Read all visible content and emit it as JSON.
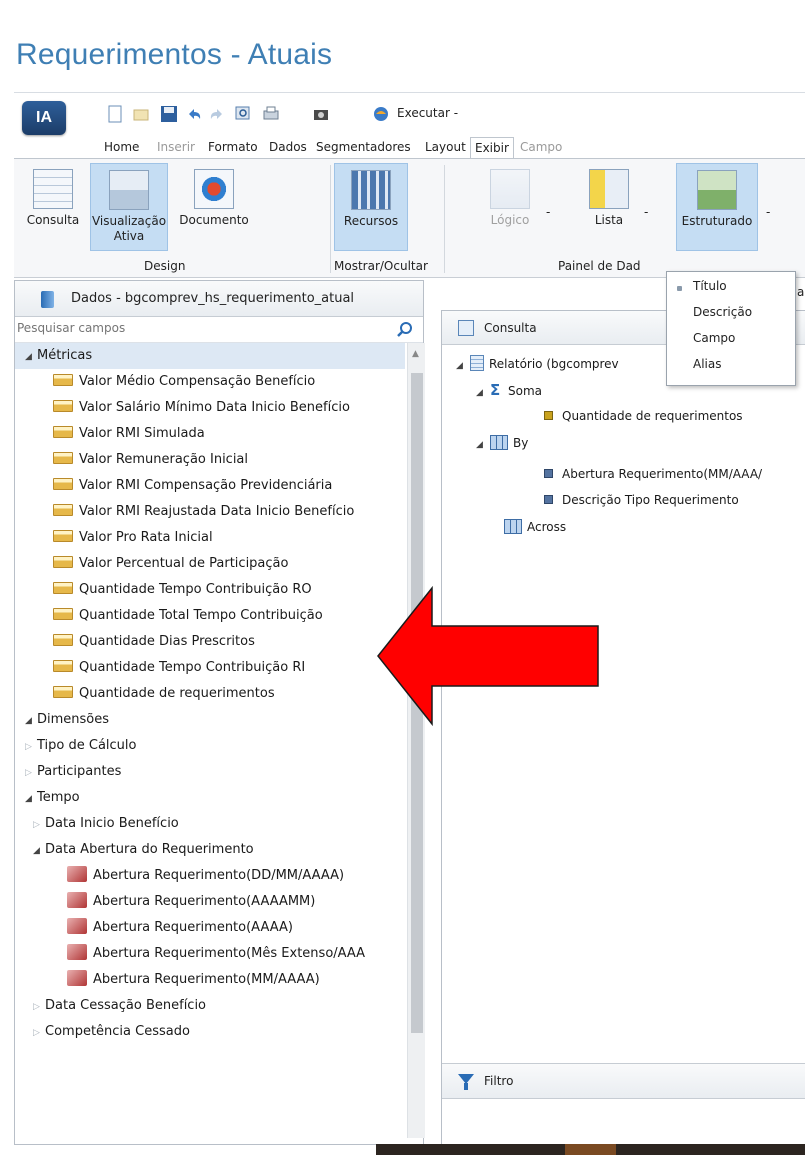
{
  "page": {
    "title": "Requerimentos - Atuais"
  },
  "toolbar": {
    "logo": "IA",
    "run_label": "Executar -",
    "tabs": [
      {
        "label": "Home",
        "state": "normal"
      },
      {
        "label": "Inserir",
        "state": "disabled"
      },
      {
        "label": "Formato",
        "state": "normal"
      },
      {
        "label": "Dados",
        "state": "normal"
      },
      {
        "label": "Segmentadores",
        "state": "normal"
      },
      {
        "label": "Layout",
        "state": "normal"
      },
      {
        "label": "Exibir",
        "state": "active"
      },
      {
        "label": "Campo",
        "state": "disabled"
      }
    ]
  },
  "ribbon": {
    "buttons": [
      {
        "label": "Consulta"
      },
      {
        "label": "Visualização Ativa"
      },
      {
        "label": "Documento"
      },
      {
        "label": "Recursos"
      },
      {
        "label": "Lógico"
      },
      {
        "label": "Lista"
      },
      {
        "label": "Estruturado"
      }
    ],
    "groups": [
      {
        "label": "Design"
      },
      {
        "label": "Mostrar/Ocultar"
      },
      {
        "label": "Painel de Dad"
      }
    ],
    "dropdown_arrows": [
      "-",
      "-",
      "-"
    ],
    "partial_char": "a"
  },
  "dropdown": {
    "items": [
      "Título",
      "Descrição",
      "Campo",
      "Alias"
    ]
  },
  "data_panel": {
    "title": "Dados - bgcomprev_hs_requerimento_atual",
    "search_placeholder": "Pesquisar campos",
    "tree": {
      "metricas": {
        "label": "Métricas",
        "items": [
          "Valor Médio Compensação Benefício",
          "Valor Salário Mínimo Data Inicio Benefício",
          "Valor RMI Simulada",
          "Valor Remuneração Inicial",
          "Valor RMI Compensação Previdenciária",
          "Valor RMI Reajustada Data Inicio Benefício",
          "Valor Pro Rata Inicial",
          "Valor Percentual de Participação",
          "Quantidade Tempo Contribuição RO",
          "Quantidade Total Tempo Contribuição",
          "Quantidade Dias Prescritos",
          "Quantidade Tempo Contribuição RI",
          "Quantidade de requerimentos"
        ]
      },
      "dimensoes": {
        "label": "Dimensões",
        "tipo_calculo": "Tipo de Cálculo",
        "participantes": "Participantes",
        "tempo": {
          "label": "Tempo",
          "data_inicio": "Data Inicio Benefício",
          "data_abertura": {
            "label": "Data Abertura do Requerimento",
            "items": [
              "Abertura Requerimento(DD/MM/AAAA)",
              "Abertura Requerimento(AAAAMM)",
              "Abertura Requerimento(AAAA)",
              "Abertura Requerimento(Mês Extenso/AAA",
              "Abertura Requerimento(MM/AAAA)"
            ]
          },
          "data_cessacao": "Data Cessação Benefício",
          "competencia": "Competência Cessado"
        }
      }
    }
  },
  "query_panel": {
    "title": "Consulta",
    "report": "Relatório (bgcomprev",
    "soma": "Soma",
    "soma_items": [
      "Quantidade de requerimentos"
    ],
    "by": "By",
    "by_items": [
      "Abertura Requerimento(MM/AAA/",
      "Descrição Tipo Requerimento"
    ],
    "across": "Across",
    "filter_title": "Filtro"
  },
  "annotation": {
    "arrow_color": "#ff0000"
  },
  "colors": {
    "title": "#3f7fb4",
    "selected_ribbon": "#c5ddf3",
    "tree_selection": "#dde8f4"
  }
}
